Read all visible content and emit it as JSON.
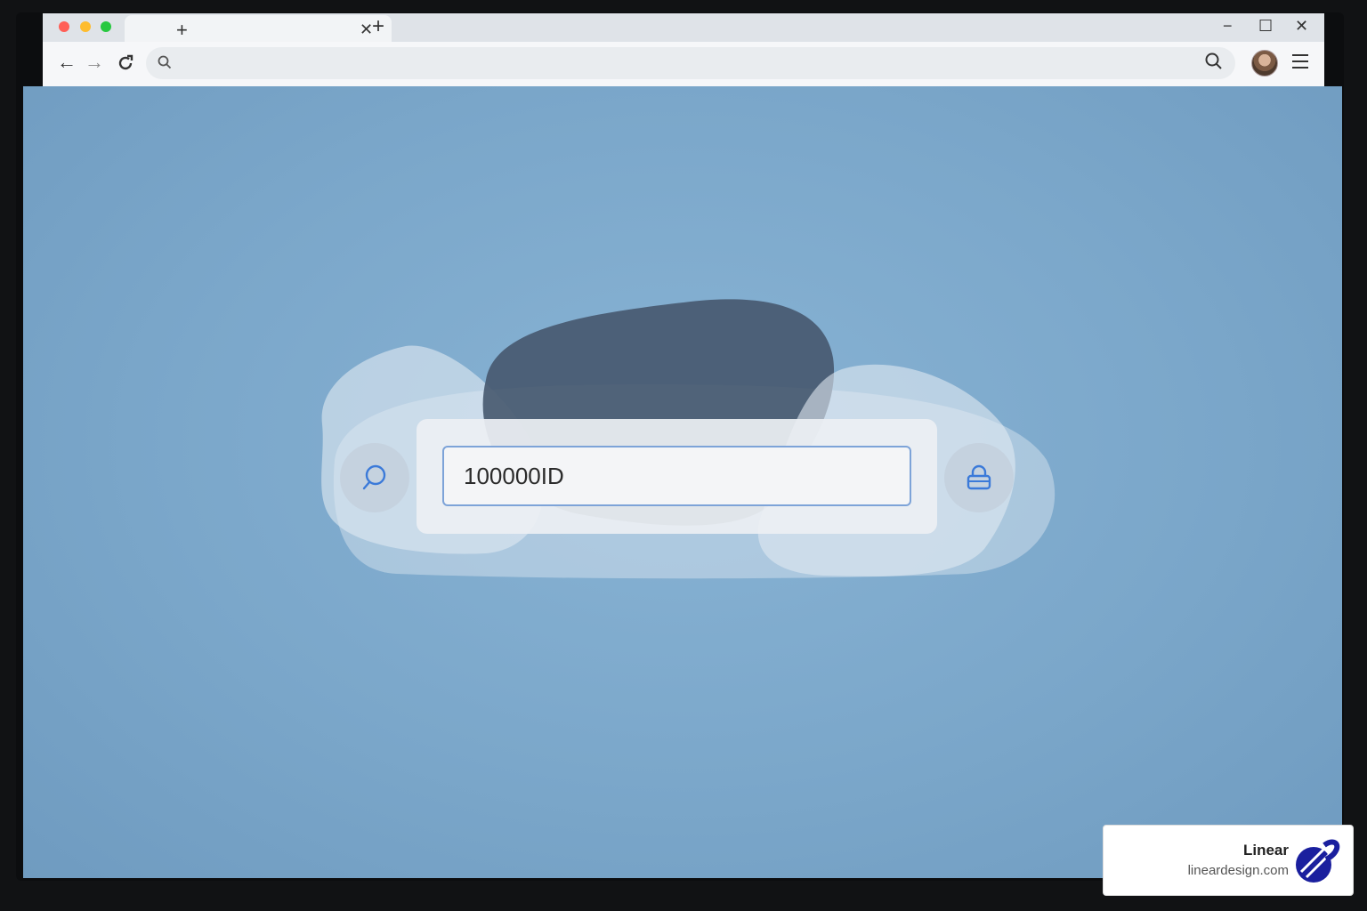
{
  "browser": {
    "tab": {
      "title": "",
      "new_tab_glyph": "+",
      "close_glyph": "✕"
    },
    "new_tab_glyph": "+",
    "window_controls": {
      "minimize": "−",
      "maximize": "☐",
      "close": "✕"
    },
    "nav": {
      "back": "←",
      "forward": "→"
    },
    "address_bar": {
      "value": ""
    },
    "colors": {
      "red": "#ff5f57",
      "yellow": "#febc2e",
      "green": "#28c840"
    }
  },
  "page": {
    "id_input": {
      "value": "100000ID"
    },
    "left_button_icon": "search-icon",
    "right_button_icon": "lock-icon",
    "accent": "#3b7ad9"
  },
  "watermark": {
    "name": "Linear",
    "url": "lineardesign.com"
  }
}
